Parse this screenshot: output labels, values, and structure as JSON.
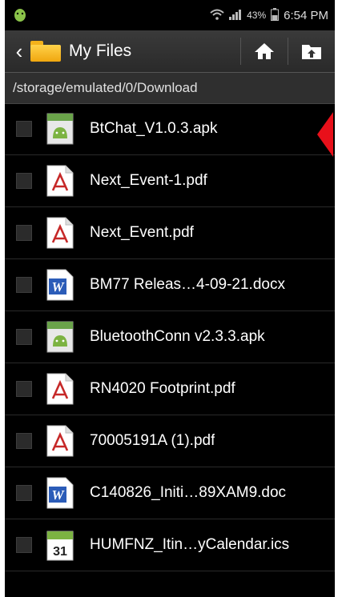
{
  "status": {
    "battery": "43%",
    "time": "6:54 PM"
  },
  "header": {
    "title": "My Files"
  },
  "path": "/storage/emulated/0/Download",
  "files": [
    {
      "name": "BtChat_V1.0.3.apk",
      "type": "apk"
    },
    {
      "name": "Next_Event-1.pdf",
      "type": "pdf"
    },
    {
      "name": "Next_Event.pdf",
      "type": "pdf"
    },
    {
      "name": "BM77 Releas…4-09-21.docx",
      "type": "word"
    },
    {
      "name": "BluetoothConn v2.3.3.apk",
      "type": "apk"
    },
    {
      "name": "RN4020 Footprint.pdf",
      "type": "pdf"
    },
    {
      "name": "70005191A (1).pdf",
      "type": "pdf"
    },
    {
      "name": "C140826_Initi…89XAM9.doc",
      "type": "word"
    },
    {
      "name": "HUMFNZ_Itin…yCalendar.ics",
      "type": "calendar"
    }
  ],
  "calendar_icon_day": "31",
  "colors": {
    "pointer": "#e8101a",
    "folder": "#f3b21b"
  }
}
